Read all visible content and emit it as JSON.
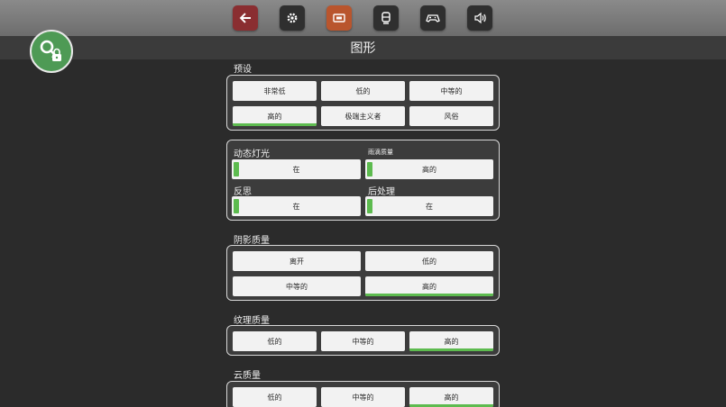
{
  "toolbar": {
    "buttons": [
      {
        "icon": "back-arrow-icon",
        "active": false
      },
      {
        "icon": "gear-icon",
        "active": false
      },
      {
        "icon": "display-icon",
        "active": true
      },
      {
        "icon": "train-icon",
        "active": false
      },
      {
        "icon": "gamepad-icon",
        "active": false
      },
      {
        "icon": "speaker-icon",
        "active": false
      }
    ]
  },
  "page": {
    "title": "图形"
  },
  "colors": {
    "accent": "#5dbb4f",
    "active_tab": "#b9552d",
    "back": "#8a2e31",
    "badge": "#4e9a55"
  },
  "presets": {
    "label": "预设",
    "options": [
      "非常低",
      "低的",
      "中等的",
      "高的",
      "极端主义者",
      "风俗"
    ],
    "selected": "高的"
  },
  "lighting": {
    "dynamic_light": {
      "label": "动态灯光",
      "value": "在"
    },
    "rain_quality": {
      "label": "雨滴质量",
      "value": "高的"
    },
    "reflection": {
      "label": "反思",
      "value": "在"
    },
    "post_processing": {
      "label": "后处理",
      "value": "在"
    }
  },
  "shadow_quality": {
    "label": "阴影质量",
    "options": [
      "离开",
      "低的",
      "中等的",
      "高的"
    ],
    "selected": "高的"
  },
  "texture_quality": {
    "label": "纹理质量",
    "options": [
      "低的",
      "中等的",
      "高的"
    ],
    "selected": "高的"
  },
  "cloud_quality": {
    "label": "云质量",
    "options": [
      "低的",
      "中等的",
      "高的"
    ],
    "selected": "高的"
  }
}
